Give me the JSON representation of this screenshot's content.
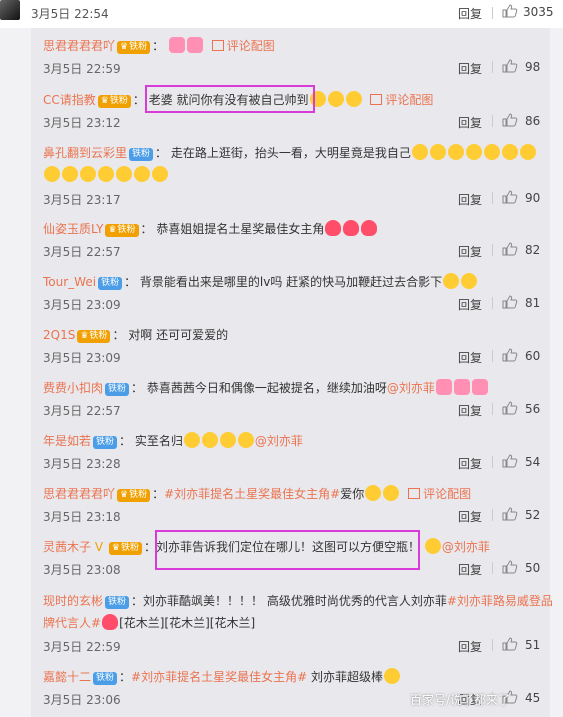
{
  "top": {
    "time": "3月5日 22:54",
    "reply": "回复",
    "likes": "3035"
  },
  "comments": [
    {
      "user": "思君君君君吖",
      "badge": "铁粉",
      "sep": "：",
      "text": "",
      "pic": "评论配图",
      "time": "3月5日 22:59",
      "reply": "回复",
      "likes": "98"
    },
    {
      "user": "CC请指教",
      "badge": "铁粉",
      "sep": "：",
      "text": "老婆 就问你有没有被自己帅到",
      "pic": "评论配图",
      "time": "3月5日 23:12",
      "reply": "回复",
      "likes": "86"
    },
    {
      "user": "鼻孔翻到云彩里",
      "badge": "铁粉",
      "sep": "：",
      "text": "走在路上逛街，抬头一看，大明星竟是我自己",
      "time": "3月5日 23:17",
      "reply": "回复",
      "likes": "90"
    },
    {
      "user": "仙姿玉质LY",
      "badge": "铁粉",
      "sep": "：",
      "text": "恭喜姐姐提名土星奖最佳女主角",
      "time": "3月5日 22:57",
      "reply": "回复",
      "likes": "82"
    },
    {
      "user": "Tour_Wei",
      "badge": "铁粉",
      "sep": "：",
      "text": "背景能看出来是哪里的lv吗  赶紧的快马加鞭赶过去合影下",
      "time": "3月5日 23:09",
      "reply": "回复",
      "likes": "81"
    },
    {
      "user": "2Q1S",
      "badge": "铁粉",
      "sep": "：",
      "text": "对啊 还可可爱爱的",
      "time": "3月5日 23:09",
      "reply": "回复",
      "likes": "60"
    },
    {
      "user": "费费小扣肉",
      "badge": "铁粉",
      "sep": "：",
      "text": "恭喜茜茜今日和偶像一起被提名，继续加油呀",
      "mention": "@刘亦菲",
      "time": "3月5日 22:57",
      "reply": "回复",
      "likes": "56"
    },
    {
      "user": "年是如若",
      "badge": "铁粉",
      "sep": "：",
      "text": "实至名归",
      "mention": "@刘亦菲",
      "time": "3月5日 23:28",
      "reply": "回复",
      "likes": "54"
    },
    {
      "user": "思君君君君吖",
      "badge": "铁粉",
      "sep": "：",
      "tag": "#刘亦菲提名土星奖最佳女主角#",
      "text": "爱你",
      "pic": "评论配图",
      "time": "3月5日 23:18",
      "reply": "回复",
      "likes": "52"
    },
    {
      "user": "灵茜木子",
      "badge": "铁粉",
      "sep": "：",
      "text": "刘亦菲告诉我们定位在哪儿！这图可以方便空瓶！",
      "mention": "@刘亦菲",
      "time": "3月5日 23:08",
      "reply": "回复",
      "likes": "50"
    },
    {
      "user": "现时的玄彬",
      "badge": "铁粉",
      "sep": "：",
      "text": "刘亦菲酷飒美！！！！ 高级优雅时尚优秀的代言人刘亦菲",
      "tag": "#刘亦菲路易威登品牌代言人#",
      "text2": "[花木兰][花木兰][花木兰]",
      "time": "3月5日 22:59",
      "reply": "回复",
      "likes": "51"
    },
    {
      "user": "嘉懿十二",
      "badge": "铁粉",
      "sep": "：",
      "tag": "#刘亦菲提名土星奖最佳女主角#",
      "text": " 刘亦菲超级棒",
      "time": "3月5日 23:06",
      "reply": "回复",
      "likes": "45"
    }
  ],
  "watermark": "百家号/说了都来了"
}
